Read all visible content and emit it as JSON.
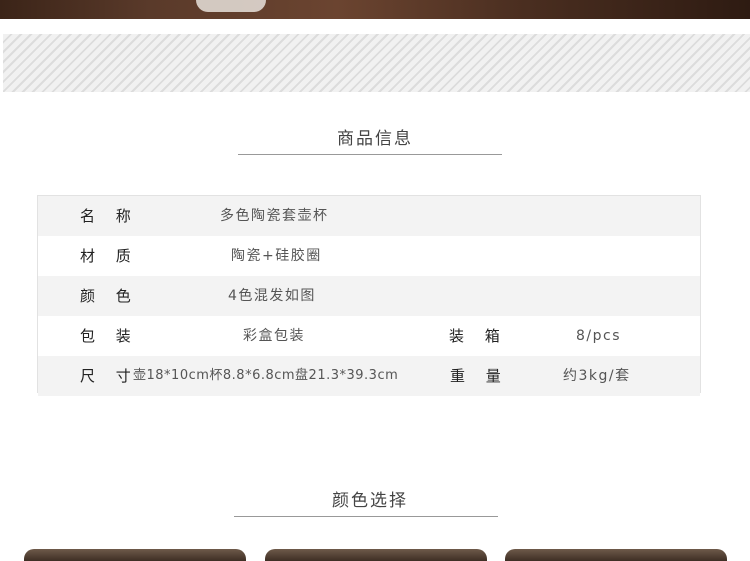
{
  "product_info": {
    "title": "商品信息",
    "rows": [
      {
        "label": "名 称",
        "value": "多色陶瓷套壶杯"
      },
      {
        "label": "材 质",
        "value": "陶瓷+硅胶圈"
      },
      {
        "label": "颜 色",
        "value": "4色混发如图"
      },
      {
        "label": "包 装",
        "value": "彩盒包装",
        "label2": "装 箱",
        "value2": "8/pcs"
      },
      {
        "label": "尺 寸",
        "value": "壶18*10cm杯8.8*6.8cm盘21.3*39.3cm",
        "label2": "重 量",
        "value2": "约3kg/套"
      }
    ]
  },
  "color_select": {
    "title": "颜色选择"
  }
}
